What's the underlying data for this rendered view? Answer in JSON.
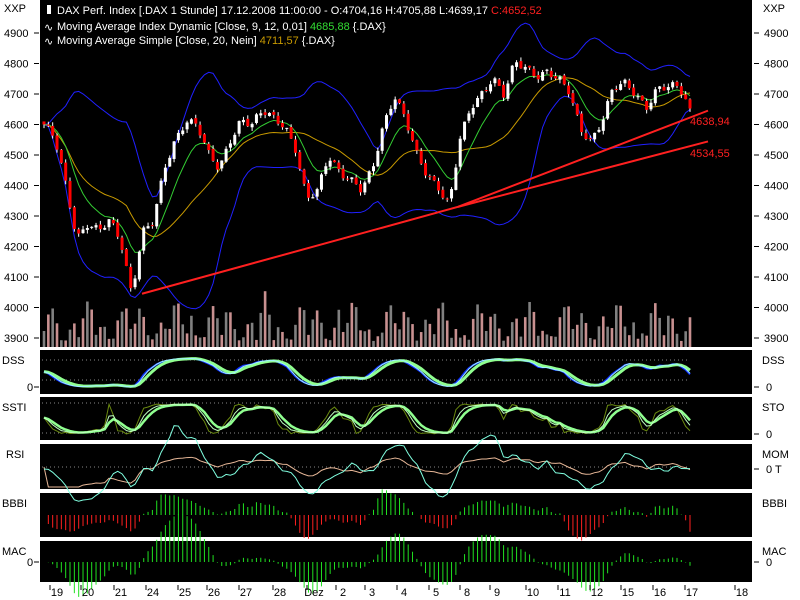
{
  "header": {
    "unit_left": "XXP",
    "unit_right": "XXP",
    "line1_text": "DAX Perf. Index [.DAX  1 Stunde] 17.12.2008 11:00:00 - O:4704,16 H:4705,88 L:4639,17 ",
    "line1_close": "C:4652,52",
    "line2_text": "Moving Average Index Dynamic [Close, 9, 12, 0,01] ",
    "line2_value": "4685,88",
    "line2_suffix": " {.DAX}",
    "line3_text": "Moving Average Simple [Close, 20, Nein] ",
    "line3_value": "4711,57",
    "line3_suffix": " {.DAX}"
  },
  "colors": {
    "background": "#000000",
    "up_candle": "#ffffff",
    "down_candle": "#ff0000",
    "ma_dynamic": "#33cc33",
    "ma_simple": "#c89a00",
    "bands": "#2020ff",
    "trendline": "#ff2020",
    "volume_a": "#c89090",
    "volume_b": "#808080"
  },
  "chart_data": {
    "type": "candlestick",
    "title": "DAX Perf. Index [.DAX  1 Stunde]",
    "ylim": [
      3870,
      4950
    ],
    "y_ticks": [
      "4900",
      "4800",
      "4700",
      "4600",
      "4500",
      "4400",
      "4300",
      "4200",
      "4100",
      "4000",
      "3900"
    ],
    "x_ticks": [
      "19",
      "20",
      "21",
      "24",
      "25",
      "26",
      "27",
      "28",
      "Dez",
      "2",
      "3",
      "4",
      "5",
      "8",
      "9",
      "10",
      "11",
      "12",
      "15",
      "16",
      "17",
      "18"
    ],
    "close_approx": [
      4600,
      4550,
      4400,
      4230,
      4280,
      4250,
      4280,
      4220,
      4050,
      4250,
      4280,
      4450,
      4550,
      4620,
      4600,
      4500,
      4450,
      4550,
      4620,
      4600,
      4640,
      4620,
      4600,
      4520,
      4350,
      4380,
      4500,
      4450,
      4420,
      4380,
      4450,
      4600,
      4700,
      4620,
      4500,
      4430,
      4400,
      4340,
      4550,
      4650,
      4700,
      4760,
      4700,
      4800,
      4780,
      4760,
      4780,
      4750,
      4700,
      4580,
      4550,
      4620,
      4720,
      4730,
      4700,
      4660,
      4720,
      4720,
      4720,
      4652
    ],
    "trendlines": [
      {
        "label": "4638,94",
        "from_price": 4045,
        "via_price": 4330,
        "end_price": 4638.94
      },
      {
        "label": "4534,55",
        "from_price": 4330,
        "end_price": 4534.55
      }
    ],
    "grid": false
  },
  "panels": [
    {
      "left": "DSS",
      "right": "DSS",
      "zero_left": "0",
      "zero_right": "0"
    },
    {
      "left": "SSTI",
      "right": "STO",
      "zero_left": "",
      "zero_right": "0"
    },
    {
      "left": "RSI",
      "right": "MOM",
      "zero_left": "",
      "zero_right": "0 T"
    },
    {
      "left": "BBBI",
      "right": "BBBI",
      "zero_left": "",
      "zero_right": ""
    },
    {
      "left": "MAC",
      "right": "MAC",
      "zero_left": "0",
      "zero_right": "0"
    }
  ]
}
